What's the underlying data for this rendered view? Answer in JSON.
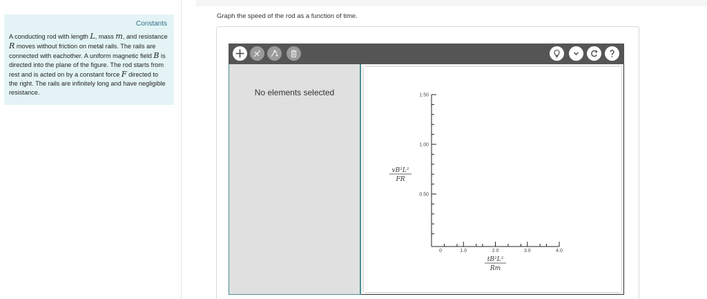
{
  "constants": {
    "title": "Constants",
    "line1_pre": "A conducting rod with length ",
    "var_L": "L",
    "line1_mid": ", mass ",
    "var_m": "m",
    "line1_post": ", and resistance ",
    "var_R": "R",
    "line2": " moves without friction on metal rails. The rails are connected with eachother. A uniform magnetic field ",
    "var_B": "B",
    "line3": " is directed into the plane of the figure. The rod starts from rest and is acted on by a constant force ",
    "var_F": "F",
    "line4": " directed to the right. The rails are infinitely long and have negligible resistance."
  },
  "question": "Graph the speed of the rod as a function of time.",
  "toolbar": {
    "add_icon": "plus-icon",
    "eraser_icon": "eraser-icon",
    "vertex_icon": "vertex-icon",
    "delete_icon": "trash-icon",
    "hint_icon": "lightbulb-icon",
    "more_icon": "chevron-down-icon",
    "reset_icon": "reset-icon",
    "help_icon": "help-icon"
  },
  "left_pane": {
    "status": "No elements selected"
  },
  "graph": {
    "y_ticks": [
      "1.50",
      "1.00",
      "0.50"
    ],
    "x_ticks": [
      "0",
      "1.0",
      "2.0",
      "3.0",
      "4.0"
    ],
    "y_label_num": "vB²L²",
    "y_label_den": "FR",
    "x_label_num": "tB²L²",
    "x_label_den": "Rm"
  }
}
